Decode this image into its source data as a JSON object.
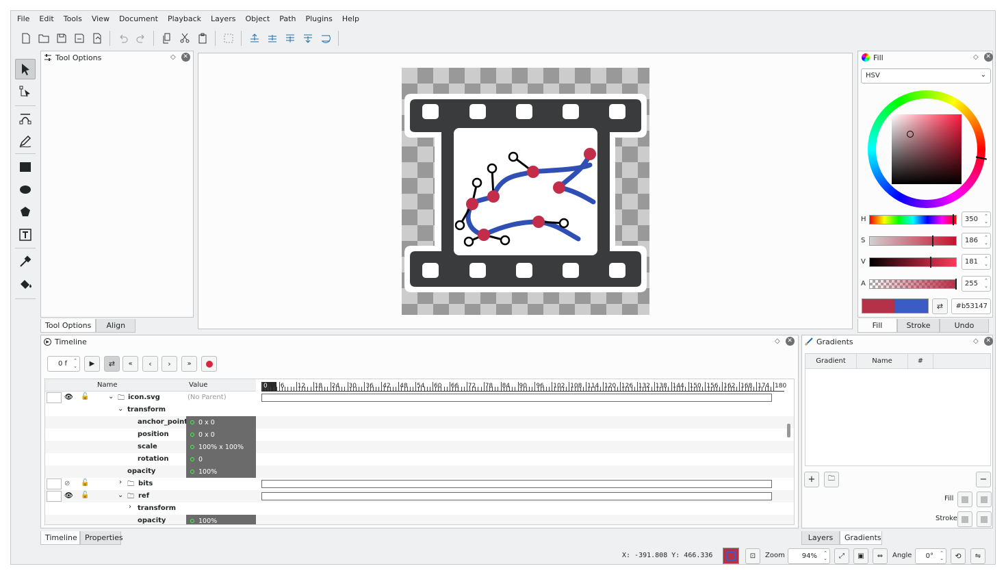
{
  "menu": [
    "File",
    "Edit",
    "Tools",
    "View",
    "Document",
    "Playback",
    "Layers",
    "Object",
    "Path",
    "Plugins",
    "Help"
  ],
  "toolbar_icons": [
    "new-file-icon",
    "open-file-icon",
    "save-icon",
    "save-as-icon",
    "export-icon",
    "undo-icon",
    "redo-icon",
    "copy-icon",
    "cut-icon",
    "paste-icon",
    "group-icon",
    "raise-to-top-icon",
    "raise-icon",
    "lower-icon",
    "lower-to-bottom-icon",
    "flip-icon"
  ],
  "tools": [
    "select-tool",
    "edit-nodes-tool",
    "draw-bezier-tool",
    "freehand-tool",
    "rectangle-tool",
    "ellipse-tool",
    "star-tool",
    "text-tool",
    "color-picker-tool",
    "fill-tool"
  ],
  "tool_options": {
    "title": "Tool Options",
    "tabs": [
      "Tool Options",
      "Align"
    ]
  },
  "fill": {
    "title": "Fill",
    "mode": "HSV",
    "sliders": [
      {
        "label": "H",
        "value": "350",
        "pos": 0.97
      },
      {
        "label": "S",
        "value": "186",
        "pos": 0.73
      },
      {
        "label": "V",
        "value": "181",
        "pos": 0.71
      },
      {
        "label": "A",
        "value": "255",
        "pos": 1.0
      }
    ],
    "hex": "#b53147",
    "color": "#b53147",
    "secondary": "#3b5cc4",
    "tabs": [
      "Fill",
      "Stroke",
      "Undo History"
    ]
  },
  "timeline": {
    "title": "Timeline",
    "frame": "0 f",
    "columns": [
      "Name",
      "Value"
    ],
    "ticks": [
      "0",
      "6",
      "12",
      "18",
      "24",
      "30",
      "36",
      "42",
      "48",
      "54",
      "60",
      "66",
      "72",
      "78",
      "84",
      "90",
      "96",
      "102",
      "108",
      "114",
      "120",
      "126",
      "132",
      "138",
      "144",
      "150",
      "156",
      "162",
      "168",
      "174",
      "180"
    ],
    "rows": [
      {
        "name": "icon.svg",
        "value": "(No Parent)"
      },
      {
        "name": "transform"
      },
      {
        "name": "anchor_point",
        "value": "0 x 0"
      },
      {
        "name": "position",
        "value": "0 x 0"
      },
      {
        "name": "scale",
        "value": "100% x 100%"
      },
      {
        "name": "rotation",
        "value": "0"
      },
      {
        "name": "opacity",
        "value": "100%"
      },
      {
        "name": "bits"
      },
      {
        "name": "ref"
      },
      {
        "name": "transform"
      },
      {
        "name": "opacity",
        "value": "100%"
      }
    ],
    "tabs": [
      "Timeline",
      "Properties"
    ]
  },
  "gradients": {
    "title": "Gradients",
    "columns": [
      "Gradient",
      "Name",
      "#"
    ],
    "fill_label": "Fill",
    "stroke_label": "Stroke",
    "tabs": [
      "Layers",
      "Gradients"
    ]
  },
  "status": {
    "coords": "X: -391.808 Y:  466.336",
    "zoom_label": "Zoom",
    "zoom": "94%",
    "angle_label": "Angle",
    "angle": "0°"
  }
}
